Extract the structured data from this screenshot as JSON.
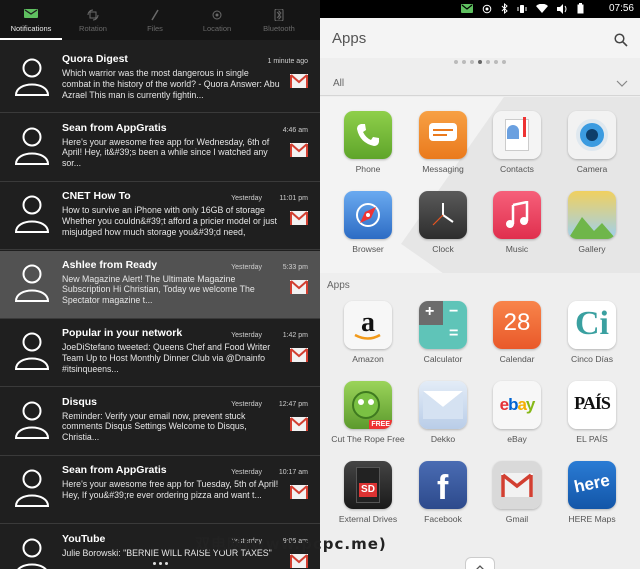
{
  "tabs": [
    {
      "label": "Notifications",
      "icon": "notification-icon",
      "active": true
    },
    {
      "label": "Rotation",
      "icon": "rotation-icon",
      "active": false
    },
    {
      "label": "Files",
      "icon": "files-icon",
      "active": false
    },
    {
      "label": "Location",
      "icon": "location-icon",
      "active": false
    },
    {
      "label": "Bluetooth",
      "icon": "bluetooth-icon",
      "active": false
    }
  ],
  "notifications": [
    {
      "title": "Quora Digest",
      "date": "",
      "time": "1 minute ago",
      "body": "Which warrior was the most dangerous in single combat in the history of the world? - Quora Answer: Abu Azrael This man is currently fightin..."
    },
    {
      "title": "Sean from AppGratis",
      "date": "",
      "time": "4:46 am",
      "body": "Here's your awesome free app for Wednesday, 6th of April! Hey, it&#39;s been a while since I watched any sor..."
    },
    {
      "title": "CNET How To",
      "date": "Yesterday",
      "time": "11:01 pm",
      "body": "How to survive an iPhone with only 16GB of storage Whether you couldn&#39;t afford a pricier model or just misjudged how much storage you&#39;d need,"
    },
    {
      "title": "Ashlee from Ready",
      "date": "Yesterday",
      "time": "5:33 pm",
      "body": "New Magazine Alert! The Ultimate Magazine Subscription Hi Christian, Today we welcome The Spectator magazine t..."
    },
    {
      "title": "Popular in your network",
      "date": "Yesterday",
      "time": "1:42 pm",
      "body": "JoeDiStefano tweeted: Queens Chef and Food Writer Team Up to Host Monthly Dinner Club  via @Dnainfo #itsinqueens..."
    },
    {
      "title": "Disqus",
      "date": "Yesterday",
      "time": "12:47 pm",
      "body": "Reminder: Verify your email now, prevent stuck comments Disqus Settings Welcome to Disqus, Christia..."
    },
    {
      "title": "Sean from AppGratis",
      "date": "Yesterday",
      "time": "10:17 am",
      "body": "Here's your awesome free app for Tuesday, 5th of April! Hey, If you&#39;re ever ordering pizza and want t..."
    },
    {
      "title": "YouTube",
      "date": "Yesterday",
      "time": "9:06 am",
      "body": "Julie Borowski: \"BERNIE WILL RAISE YOUR TAXES\""
    }
  ],
  "status": {
    "time": "07:56"
  },
  "apps_header": {
    "title": "Apps"
  },
  "scope": {
    "label": "All"
  },
  "section": {
    "label": "Apps"
  },
  "favorites": [
    {
      "label": "Phone",
      "icon": "phone-icon"
    },
    {
      "label": "Messaging",
      "icon": "messaging-icon"
    },
    {
      "label": "Contacts",
      "icon": "contacts-icon"
    },
    {
      "label": "Camera",
      "icon": "camera-icon"
    },
    {
      "label": "Browser",
      "icon": "browser-icon"
    },
    {
      "label": "Clock",
      "icon": "clock-icon"
    },
    {
      "label": "Music",
      "icon": "music-icon"
    },
    {
      "label": "Gallery",
      "icon": "gallery-icon"
    }
  ],
  "apps": [
    {
      "label": "Amazon",
      "icon": "amazon-icon"
    },
    {
      "label": "Calculator",
      "icon": "calculator-icon"
    },
    {
      "label": "Calendar",
      "icon": "calendar-icon",
      "text": "28"
    },
    {
      "label": "Cinco Días",
      "icon": "cinco-dias-icon",
      "text": "Ci"
    },
    {
      "label": "Cut The Rope Free",
      "icon": "cut-the-rope-icon",
      "text": "FREE"
    },
    {
      "label": "Dekko",
      "icon": "dekko-icon"
    },
    {
      "label": "eBay",
      "icon": "ebay-icon",
      "text": "ebay"
    },
    {
      "label": "EL PAÍS",
      "icon": "el-pais-icon",
      "text": "PAÍS"
    },
    {
      "label": "External Drives",
      "icon": "external-drives-icon",
      "text": "SD"
    },
    {
      "label": "Facebook",
      "icon": "facebook-icon",
      "text": "f"
    },
    {
      "label": "Gmail",
      "icon": "gmail-icon"
    },
    {
      "label": "HERE Maps",
      "icon": "here-maps-icon",
      "text": "here"
    }
  ],
  "watermark": "双电网(www.pcpc.me)",
  "colors": {
    "accent": "#E95420",
    "gmail_red": "#D23F31"
  }
}
